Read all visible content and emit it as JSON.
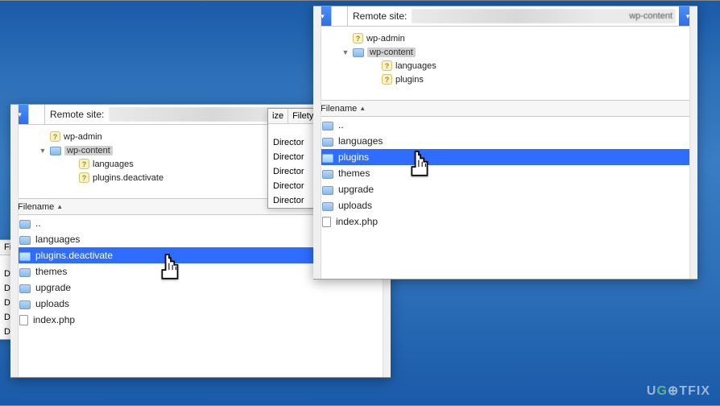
{
  "labels": {
    "remote_site": "Remote site:",
    "filename_col": "Filename",
    "filetype_col": "Filetype",
    "ize_col": "ize",
    "director_text": "Director"
  },
  "right_window": {
    "path_suffix": "wp-content",
    "tree": {
      "wp_admin": "wp-admin",
      "wp_content": "wp-content",
      "languages": "languages",
      "plugins": "plugins"
    },
    "files": [
      {
        "name": "..",
        "type": "up"
      },
      {
        "name": "languages",
        "type": "folder"
      },
      {
        "name": "plugins",
        "type": "folder",
        "selected": true
      },
      {
        "name": "themes",
        "type": "folder"
      },
      {
        "name": "upgrade",
        "type": "folder"
      },
      {
        "name": "uploads",
        "type": "folder"
      },
      {
        "name": "index.php",
        "type": "file"
      }
    ]
  },
  "left_window": {
    "path_suffix": "",
    "tree": {
      "wp_admin": "wp-admin",
      "wp_content": "wp-content",
      "languages": "languages",
      "plugins_deact": "plugins.deactivate"
    },
    "files": [
      {
        "name": "..",
        "type": "up"
      },
      {
        "name": "languages",
        "type": "folder"
      },
      {
        "name": "plugins.deactivate",
        "type": "folder",
        "selected": true
      },
      {
        "name": "themes",
        "type": "folder"
      },
      {
        "name": "upgrade",
        "type": "folder"
      },
      {
        "name": "uploads",
        "type": "folder"
      },
      {
        "name": "index.php",
        "type": "file"
      }
    ]
  },
  "watermark": "UG⊕TFIX"
}
